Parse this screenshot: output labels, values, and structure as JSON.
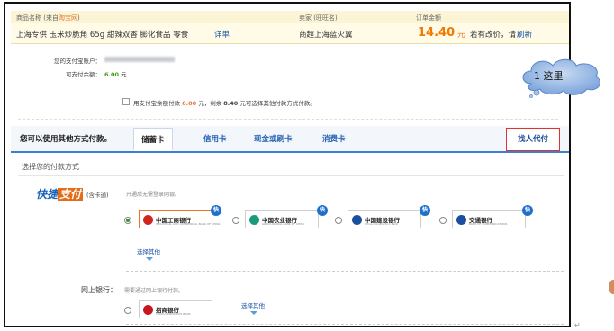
{
  "order": {
    "headers": {
      "product": "商品名称 (来自",
      "product_source": "淘宝网",
      "product_end": ")",
      "seller": "卖家 (旺旺名)",
      "amount": "订单金额"
    },
    "product_name": "上海专供 玉米炒脆角 65g 甜辣双香 膨化食品 零食",
    "details_link": "详单",
    "seller_name": "商超上海蓝火翼",
    "amount_value": "14.40",
    "amount_unit": "元",
    "price_change_note": "若有改价，请",
    "refresh_link": "刷新"
  },
  "account": {
    "account_label": "您的支付宝账户：",
    "balance_label": "可支付余额：",
    "balance_value": "6.00",
    "balance_unit": "元",
    "use_balance_prefix": "用支付宝余额付款",
    "use_balance_amount": "6.00",
    "use_balance_mid": "元，剩余",
    "use_balance_rest": "8.40",
    "use_balance_suffix": "元可选择其他付款方式付款。"
  },
  "tabs": {
    "intro": "您可以使用其他方式付款。",
    "items": [
      "储蓄卡",
      "信用卡",
      "现金或刷卡",
      "消费卡"
    ],
    "active": "储蓄卡",
    "find_pay": "找人代付"
  },
  "section_title": "选择您的付款方式",
  "express": {
    "logo_a": "快捷",
    "logo_b": "支付",
    "sub": "(含卡通)",
    "note": "开通后无需登录网银。",
    "banks": [
      {
        "name": "中国工商银行",
        "en": "INDUSTRIAL AND COMMERCIAL BANK OF CHINA",
        "color": "#d0251c",
        "selected": true
      },
      {
        "name": "中国农业银行",
        "en": "AGRICULTURAL BANK OF CHINA",
        "color": "#169b7d",
        "selected": false
      },
      {
        "name": "中国建设银行",
        "en": "China Construction Bank",
        "color": "#1a4f9e",
        "selected": false
      },
      {
        "name": "交通银行",
        "en": "BANK OF COMMUNICATIONS",
        "color": "#1b4da0",
        "selected": false
      }
    ],
    "quick_badge": "快",
    "more": "选择其他"
  },
  "online": {
    "label": "网上银行：",
    "note": "需要通过网上银行付款。",
    "bank": {
      "name": "招商银行",
      "en": "CHINA MERCHANTS BANK",
      "color": "#c8161d"
    },
    "more": "选择其他"
  },
  "callout": {
    "text": "1 这里"
  },
  "return_mark": "↵"
}
